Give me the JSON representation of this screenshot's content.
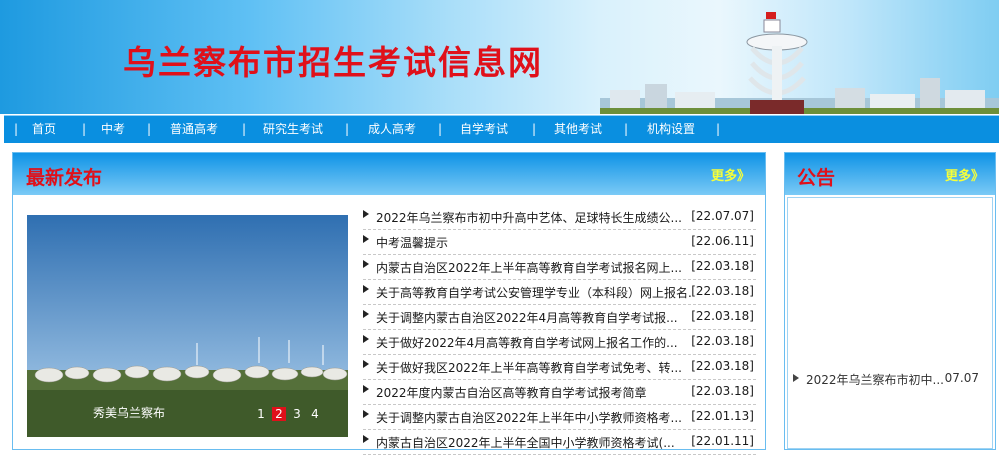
{
  "site": {
    "title": "乌兰察布市招生考试信息网"
  },
  "nav": [
    {
      "label": "首页"
    },
    {
      "label": "中考"
    },
    {
      "label": "普通高考"
    },
    {
      "label": "研究生考试"
    },
    {
      "label": "成人高考"
    },
    {
      "label": "自学考试"
    },
    {
      "label": "其他考试"
    },
    {
      "label": "机构设置"
    }
  ],
  "latest": {
    "title": "最新发布",
    "more": "更多》",
    "slider": {
      "caption": "秀美乌兰察布",
      "pages": [
        "1",
        "2",
        "3",
        "4"
      ],
      "active_page": "2"
    },
    "items": [
      {
        "title": "2022年乌兰察布市初中升高中艺体、足球特长生成绩公...",
        "date": "[22.07.07]"
      },
      {
        "title": "中考温馨提示",
        "date": "[22.06.11]"
      },
      {
        "title": "内蒙古自治区2022年上半年高等教育自学考试报名网上...",
        "date": "[22.03.18]"
      },
      {
        "title": "关于高等教育自学考试公安管理学专业（本科段）网上报名...",
        "date": "[22.03.18]"
      },
      {
        "title": "关于调整内蒙古自治区2022年4月高等教育自学考试报...",
        "date": "[22.03.18]"
      },
      {
        "title": "关于做好2022年4月高等教育自学考试网上报名工作的...",
        "date": "[22.03.18]"
      },
      {
        "title": "关于做好我区2022年上半年高等教育自学考试免考、转...",
        "date": "[22.03.18]"
      },
      {
        "title": "2022年度内蒙古自治区高等教育自学考试报考简章",
        "date": "[22.03.18]"
      },
      {
        "title": "关于调整内蒙古自治区2022年上半年中小学教师资格考...",
        "date": "[22.01.13]"
      },
      {
        "title": "内蒙古自治区2022年上半年全国中小学教师资格考试(...",
        "date": "[22.01.11]"
      }
    ]
  },
  "notice": {
    "title": "公告",
    "more": "更多》",
    "items": [
      {
        "title": "2022年乌兰察布市初中...",
        "date": "07.07"
      }
    ]
  }
}
